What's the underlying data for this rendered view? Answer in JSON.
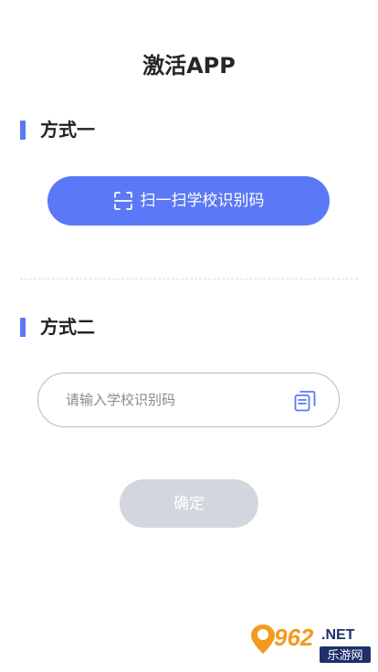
{
  "page": {
    "title": "激活APP"
  },
  "method_one": {
    "title": "方式一",
    "scan_button_label": "扫一扫学校识别码",
    "scan_icon": "scan-frame-icon"
  },
  "method_two": {
    "title": "方式二",
    "input_value": "",
    "input_placeholder": "请输入学校识别码",
    "paste_icon": "copy-paste-icon"
  },
  "confirm": {
    "label": "确定"
  },
  "watermark": {
    "number": "962",
    "domain": ".NET",
    "site_name": "乐游网"
  },
  "colors": {
    "accent": "#5b78f6",
    "disabled_button": "#d3d6de",
    "input_border": "#b9b9b9",
    "watermark_orange": "#f39a1f",
    "watermark_navy": "#1f2f6b"
  }
}
